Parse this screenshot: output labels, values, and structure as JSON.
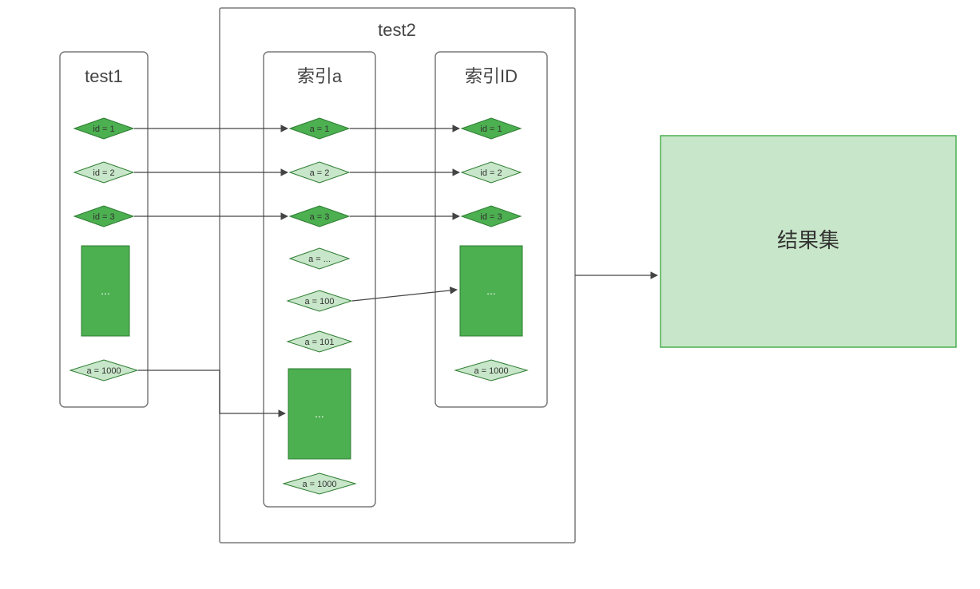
{
  "containers": {
    "test2_title": "test2",
    "test1_title": "test1",
    "indexA_title": "索引a",
    "indexID_title": "索引ID",
    "result_title": "结果集"
  },
  "test1": {
    "n1": "id = 1",
    "n2": "id = 2",
    "n3": "id = 3",
    "ellipsis": "...",
    "n_last": "a = 1000"
  },
  "indexA": {
    "n1": "a = 1",
    "n2": "a = 2",
    "n3": "a = 3",
    "n_dots": "a = ...",
    "n100": "a = 100",
    "n101": "a = 101",
    "ellipsis": "...",
    "n_last": "a = 1000"
  },
  "indexID": {
    "n1": "id = 1",
    "n2": "id = 2",
    "n3": "id = 3",
    "ellipsis": "...",
    "n_last": "a = 1000"
  },
  "colors": {
    "dark_fill": "#4caf50",
    "dark_stroke": "#2e7d32",
    "light_fill": "#c8e6c9",
    "light_stroke": "#2e7d32",
    "box_stroke": "#7a7a7a",
    "result_fill": "#c8e6c9",
    "result_stroke": "#4caf50"
  }
}
